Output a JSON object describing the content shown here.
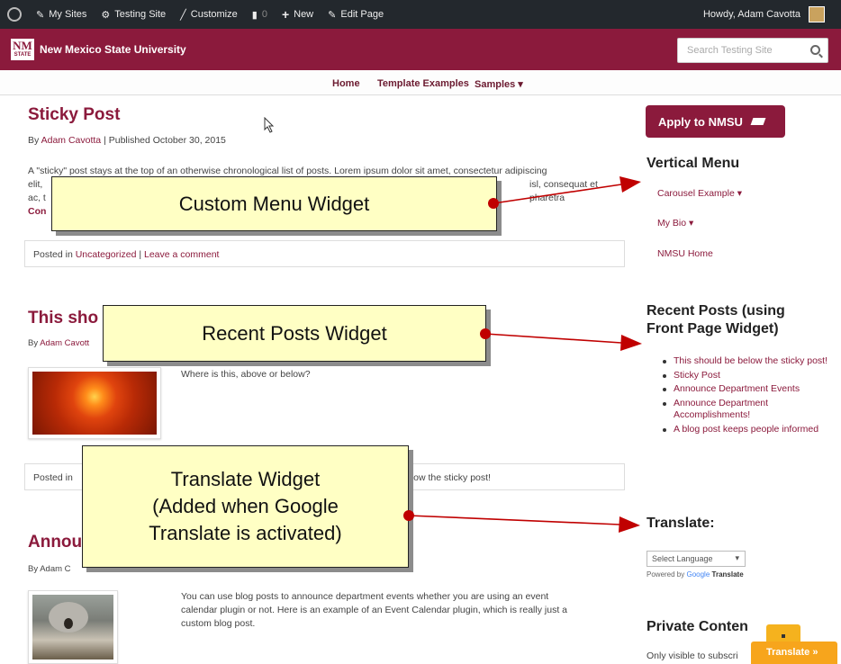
{
  "adminbar": {
    "my_sites": "My Sites",
    "site_name": "Testing Site",
    "customize": "Customize",
    "comments_count": "0",
    "new": "New",
    "edit_page": "Edit Page",
    "howdy": "Howdy, Adam Cavotta"
  },
  "brand": {
    "logo_text": "NM",
    "logo_sub": "STATE",
    "name": "New Mexico State University",
    "search_placeholder": "Search Testing Site"
  },
  "nav": {
    "home": "Home",
    "template_examples": "Template Examples",
    "samples": "Samples ▾"
  },
  "posts": [
    {
      "title": "Sticky Post",
      "by": "By",
      "author": "Adam Cavotta",
      "published": "| Published October 30, 2015",
      "excerpt_line1": "A \"sticky\" post stays at the top of an otherwise chronological list of posts.   Lorem ipsum dolor sit amet, consectetur adipiscing",
      "excerpt_line2_left": "elit,",
      "excerpt_line2_right": "isl, consequat et pharetra",
      "excerpt_line3_left": "ac, t",
      "excerpt_line4_left": "Con",
      "posted_in": "Posted in",
      "category": "Uncategorized",
      "separator": "|",
      "comment_link": "Leave a comment"
    },
    {
      "title_visible": "This sho",
      "by": "By",
      "author_visible": "Adam Cavott",
      "body": "Where is this, above or below?",
      "posted_in_visible": "Posted in",
      "meta_right": "elow the sticky post!"
    },
    {
      "title_visible": "Annou",
      "by_visible": "By Adam C",
      "body_line1": "You can use blog posts to announce department events whether you are using an event",
      "body_line2": "calendar plugin or not. Here is an example of an Event Calendar plugin, which is really just a",
      "body_line3": "custom blog post."
    }
  ],
  "sidebar": {
    "apply_button": "Apply to NMSU",
    "vertical_menu_title": "Vertical Menu",
    "menu_items": [
      "Carousel Example ▾",
      "My Bio ▾",
      "NMSU Home"
    ],
    "recent_posts_title_line1": "Recent Posts (using",
    "recent_posts_title_line2": "Front Page Widget)",
    "recent_posts": [
      "This should be below the sticky post!",
      "Sticky Post",
      "Announce Department Events",
      "Announce Department Accomplishments!",
      "A blog post keeps people informed"
    ],
    "translate_title": "Translate:",
    "select_language": "Select Language",
    "powered_by": "Powered by",
    "google": "Google",
    "translate_word": "Translate",
    "private_title": "Private Conten",
    "private_text": "Only visible to subscri",
    "translate_tab": "Translate »"
  },
  "callouts": {
    "custom_menu": "Custom Menu Widget",
    "recent_posts": "Recent Posts Widget",
    "translate_line1": "Translate Widget",
    "translate_line2": "(Added when Google",
    "translate_line3": "Translate is activated)"
  },
  "colors": {
    "brand": "#8b1a3c",
    "adminbar": "#23282d",
    "callout_fill": "#ffffc4",
    "arrow": "#c00000",
    "translate_tab": "#f7a51c"
  },
  "icons": {
    "wordpress": "wordpress-icon",
    "sites": "my-sites-icon",
    "customize": "brush-icon",
    "comments": "comment-icon",
    "new": "plus-icon",
    "edit": "pencil-icon",
    "search": "search-icon",
    "cap": "graduation-cap-icon"
  }
}
